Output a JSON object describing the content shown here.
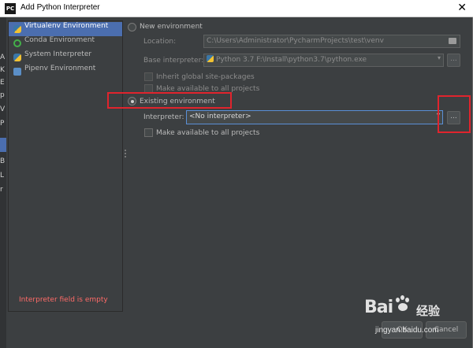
{
  "window": {
    "title": "Add Python Interpreter",
    "app_icon_text": "PC",
    "close_glyph": "✕"
  },
  "left_strip_glyphs": [
    "A",
    "K",
    "E",
    "p",
    "V",
    "P",
    "B",
    "L",
    "r"
  ],
  "sidebar": {
    "items": [
      {
        "label": "Virtualenv Environment",
        "icon": "python-icon",
        "selected": true
      },
      {
        "label": "Conda Environment",
        "icon": "conda-icon",
        "selected": false
      },
      {
        "label": "System Interpreter",
        "icon": "python-icon",
        "selected": false
      },
      {
        "label": "Pipenv Environment",
        "icon": "pipenv-icon",
        "selected": false
      }
    ]
  },
  "new_env": {
    "radio_label": "New environment",
    "selected": false,
    "location_label": "Location:",
    "location_value": "C:\\Users\\Administrator\\PycharmProjects\\test\\venv",
    "base_label": "Base interpreter:",
    "base_value": "Python 3.7 F:\\Install\\python3.7\\python.exe",
    "inherit_label": "Inherit global site-packages",
    "make_available_label": "Make available to all projects"
  },
  "existing_env": {
    "radio_label": "Existing environment",
    "selected": true,
    "interpreter_label": "Interpreter:",
    "interpreter_value": "<No interpreter>",
    "browse_label": "...",
    "make_available_label": "Make available to all projects"
  },
  "dropdown_arrow": "▾",
  "browse_label": "...",
  "error_message": "Interpreter field is empty",
  "footer": {
    "ok_label": "OK",
    "cancel_label": "Cancel"
  },
  "watermark": {
    "brand": "Bai",
    "brand_suffix": "经验",
    "url": "jingyan.baidu.com"
  },
  "colors": {
    "dialog_bg": "#3c3f41",
    "selection": "#4b6eaf",
    "focus_border": "#5a8fd6",
    "error": "#ff6b68",
    "annotation_red": "#e0242d"
  }
}
